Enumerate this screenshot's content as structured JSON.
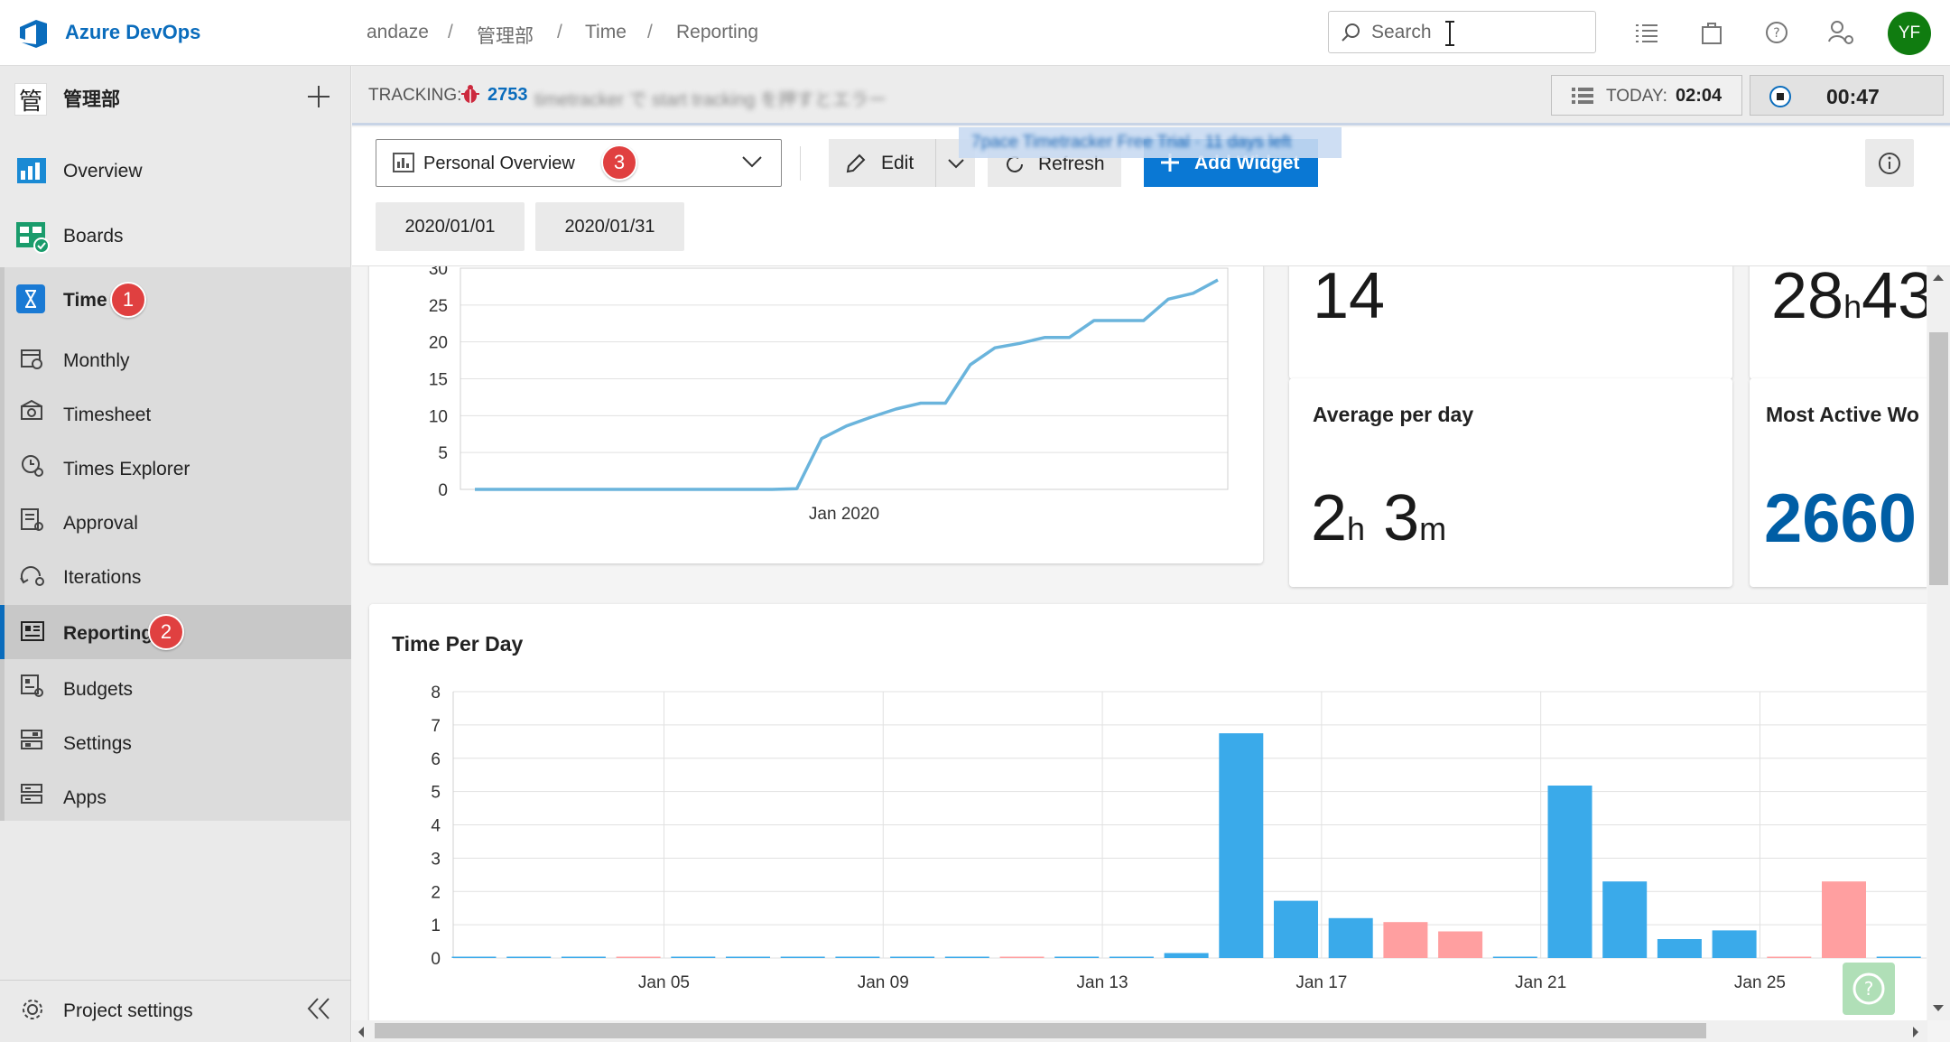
{
  "header": {
    "brand": "Azure DevOps",
    "breadcrumbs": [
      "andaze",
      "管理部",
      "Time",
      "Reporting"
    ],
    "search_placeholder": "Search",
    "avatar_initials": "YF",
    "colors": {
      "accent": "#0a6cbc",
      "avatar": "#107c10"
    }
  },
  "sidebar": {
    "project_icon_char": "管",
    "project_name": "管理部",
    "items": [
      {
        "label": "Overview",
        "icon": "overview-icon"
      },
      {
        "label": "Boards",
        "icon": "boards-icon"
      },
      {
        "label": "Time",
        "icon": "hourglass-icon",
        "badge": "1"
      },
      {
        "label": "Monthly",
        "icon": "calendar-icon"
      },
      {
        "label": "Timesheet",
        "icon": "timesheet-icon"
      },
      {
        "label": "Times Explorer",
        "icon": "times-explorer-icon"
      },
      {
        "label": "Approval",
        "icon": "approval-icon"
      },
      {
        "label": "Iterations",
        "icon": "iterations-icon"
      },
      {
        "label": "Reporting",
        "icon": "reporting-icon",
        "badge": "2"
      },
      {
        "label": "Budgets",
        "icon": "budgets-icon"
      },
      {
        "label": "Settings",
        "icon": "settings-icon"
      },
      {
        "label": "Apps",
        "icon": "apps-icon"
      }
    ],
    "footer": "Project settings"
  },
  "tracking": {
    "label": "TRACKING:",
    "work_item_id": "2753",
    "work_item_title_blurred": "timetracker で start tracking を押すとエラー",
    "today_label": "TODAY:",
    "today_value": "02:04",
    "timer_value": "00:47"
  },
  "toolbar": {
    "dashboard_name": "Personal Overview",
    "dashboard_badge": "3",
    "edit_label": "Edit",
    "refresh_label": "Refresh",
    "add_widget_label": "Add Widget",
    "trial_banner": "7pace Timetracker Free Trial · 11 days left",
    "start_date": "2020/01/01",
    "end_date": "2020/01/31"
  },
  "stats": {
    "count_value": "14",
    "total_hours": "28",
    "total_hours_unit": "h",
    "total_minutes_partial": "43",
    "avg_title": "Average per day",
    "avg_hours": "2",
    "avg_hours_unit": "h",
    "avg_minutes": "3",
    "avg_minutes_unit": "m",
    "most_active_title": "Most Active Wo",
    "most_active_value": "2660"
  },
  "chart_data": [
    {
      "type": "line",
      "x_tick_labels": [
        "Jan 2020"
      ],
      "y_ticks": [
        0,
        5,
        10,
        15,
        20,
        25,
        30
      ],
      "ylim": [
        0,
        30
      ],
      "x": [
        "Jan 01",
        "Jan 02",
        "Jan 03",
        "Jan 04",
        "Jan 05",
        "Jan 06",
        "Jan 07",
        "Jan 08",
        "Jan 09",
        "Jan 10",
        "Jan 11",
        "Jan 12",
        "Jan 13",
        "Jan 14",
        "Jan 15",
        "Jan 16",
        "Jan 17",
        "Jan 18",
        "Jan 19",
        "Jan 20",
        "Jan 21",
        "Jan 22",
        "Jan 23",
        "Jan 24",
        "Jan 25",
        "Jan 26",
        "Jan 27",
        "Jan 28",
        "Jan 29",
        "Jan 30"
      ],
      "values": [
        0,
        0,
        0,
        0,
        0,
        0,
        0,
        0,
        0,
        0,
        0,
        0,
        0,
        0.1,
        6.9,
        8.6,
        9.8,
        10.9,
        11.7,
        11.7,
        16.9,
        19.2,
        19.8,
        20.6,
        20.6,
        22.9,
        22.9,
        22.9,
        25.8,
        26.6
      ],
      "extra_last_value": 28.4,
      "grid": true,
      "color": "#6ab4dc"
    },
    {
      "type": "bar",
      "title": "Time Per Day",
      "y_ticks": [
        0,
        1,
        2,
        3,
        4,
        5,
        6,
        7,
        8
      ],
      "ylim": [
        0,
        8
      ],
      "x_tick_labels": [
        "Jan 05",
        "Jan 09",
        "Jan 13",
        "Jan 17",
        "Jan 21",
        "Jan 25"
      ],
      "categories": [
        "Jan 01",
        "Jan 02",
        "Jan 03",
        "Jan 04",
        "Jan 05",
        "Jan 06",
        "Jan 07",
        "Jan 08",
        "Jan 09",
        "Jan 10",
        "Jan 11",
        "Jan 12",
        "Jan 13",
        "Jan 14",
        "Jan 15",
        "Jan 16",
        "Jan 17",
        "Jan 18",
        "Jan 19",
        "Jan 20",
        "Jan 21",
        "Jan 22",
        "Jan 23",
        "Jan 24",
        "Jan 25",
        "Jan 26",
        "Jan 27"
      ],
      "values": [
        0,
        0,
        0,
        0,
        0,
        0,
        0,
        0,
        0,
        0,
        0,
        0,
        0,
        0.15,
        6.75,
        1.72,
        1.2,
        1.08,
        0.8,
        0,
        5.18,
        2.3,
        0.57,
        0.83,
        0,
        2.3,
        0
      ],
      "weekend": [
        false,
        false,
        false,
        true,
        false,
        false,
        false,
        false,
        false,
        false,
        true,
        false,
        false,
        false,
        false,
        false,
        false,
        true,
        true,
        false,
        false,
        false,
        false,
        false,
        true,
        true,
        false
      ],
      "colors": {
        "weekday": "#3aaaea",
        "weekend": "#ff9fa0"
      },
      "grid": true
    }
  ]
}
